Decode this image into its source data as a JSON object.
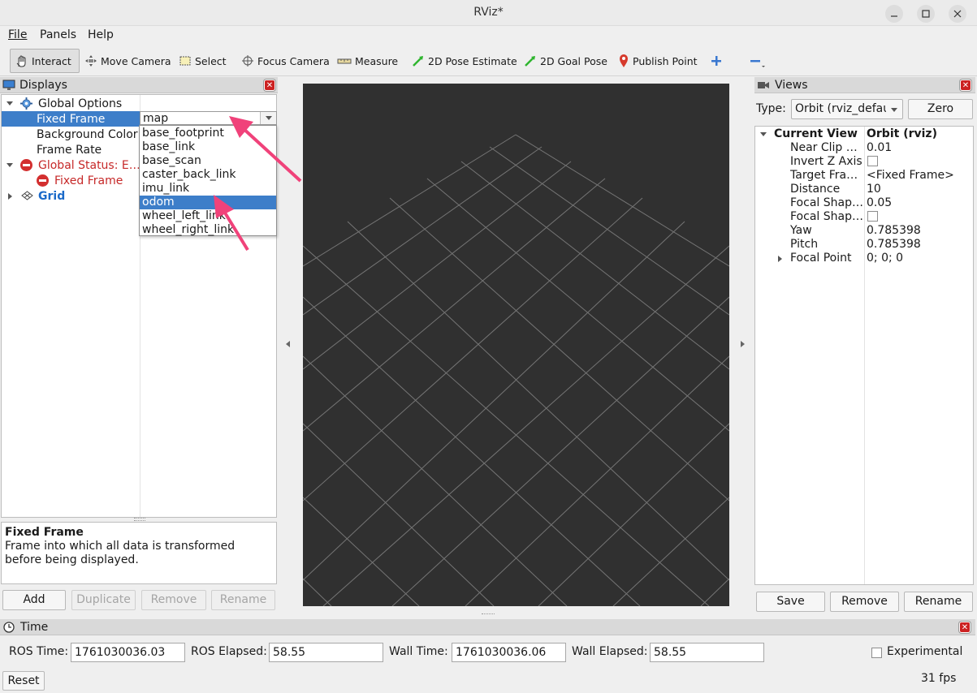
{
  "window": {
    "title": "RViz*"
  },
  "menu": {
    "file": "File",
    "panels": "Panels",
    "help": "Help"
  },
  "toolbar": {
    "interact": "Interact",
    "move_camera": "Move Camera",
    "select": "Select",
    "focus_camera": "Focus Camera",
    "measure": "Measure",
    "pose_estimate": "2D Pose Estimate",
    "goal_pose": "2D Goal Pose",
    "publish_point": "Publish Point"
  },
  "displays": {
    "title": "Displays",
    "tree": {
      "global_options": "Global Options",
      "fixed_frame": "Fixed Frame",
      "fixed_frame_value": "map",
      "background_color": "Background Color",
      "frame_rate": "Frame Rate",
      "global_status": "Global Status: E…",
      "status_fixed_frame": "Fixed Frame",
      "grid": "Grid"
    },
    "dropdown_options": [
      "base_footprint",
      "base_link",
      "base_scan",
      "caster_back_link",
      "imu_link",
      "odom",
      "wheel_left_link",
      "wheel_right_link"
    ],
    "dropdown_highlighted": "odom",
    "description": {
      "title": "Fixed Frame",
      "text": "Frame into which all data is transformed before being displayed."
    },
    "buttons": {
      "add": "Add",
      "duplicate": "Duplicate",
      "remove": "Remove",
      "rename": "Rename"
    }
  },
  "views": {
    "title": "Views",
    "type_label": "Type:",
    "type_value": "Orbit (rviz_defau",
    "zero": "Zero",
    "current_view": {
      "label": "Current View",
      "value": "Orbit (rviz)"
    },
    "properties": {
      "near_clip": {
        "label": "Near Clip …",
        "value": "0.01"
      },
      "invert_z": {
        "label": "Invert Z Axis"
      },
      "target_frame": {
        "label": "Target Fra…",
        "value": "<Fixed Frame>"
      },
      "distance": {
        "label": "Distance",
        "value": "10"
      },
      "focal_shape_size": {
        "label": "Focal Shap…",
        "value": "0.05"
      },
      "focal_shape_fixed": {
        "label": "Focal Shap…"
      },
      "yaw": {
        "label": "Yaw",
        "value": "0.785398"
      },
      "pitch": {
        "label": "Pitch",
        "value": "0.785398"
      },
      "focal_point": {
        "label": "Focal Point",
        "value": "0; 0; 0"
      }
    },
    "buttons": {
      "save": "Save",
      "remove": "Remove",
      "rename": "Rename"
    }
  },
  "time": {
    "title": "Time",
    "ros_time_label": "ROS Time:",
    "ros_time": "1761030036.03",
    "ros_elapsed_label": "ROS Elapsed:",
    "ros_elapsed": "58.55",
    "wall_time_label": "Wall Time:",
    "wall_time": "1761030036.06",
    "wall_elapsed_label": "Wall Elapsed:",
    "wall_elapsed": "58.55",
    "experimental": "Experimental",
    "reset": "Reset",
    "fps": "31 fps"
  },
  "colors": {
    "selection": "#3d7ec9",
    "error": "#c62828",
    "viewport_bg": "#303030",
    "grid_line": "#8c8c8c",
    "annotation_arrow": "#f0427a"
  }
}
